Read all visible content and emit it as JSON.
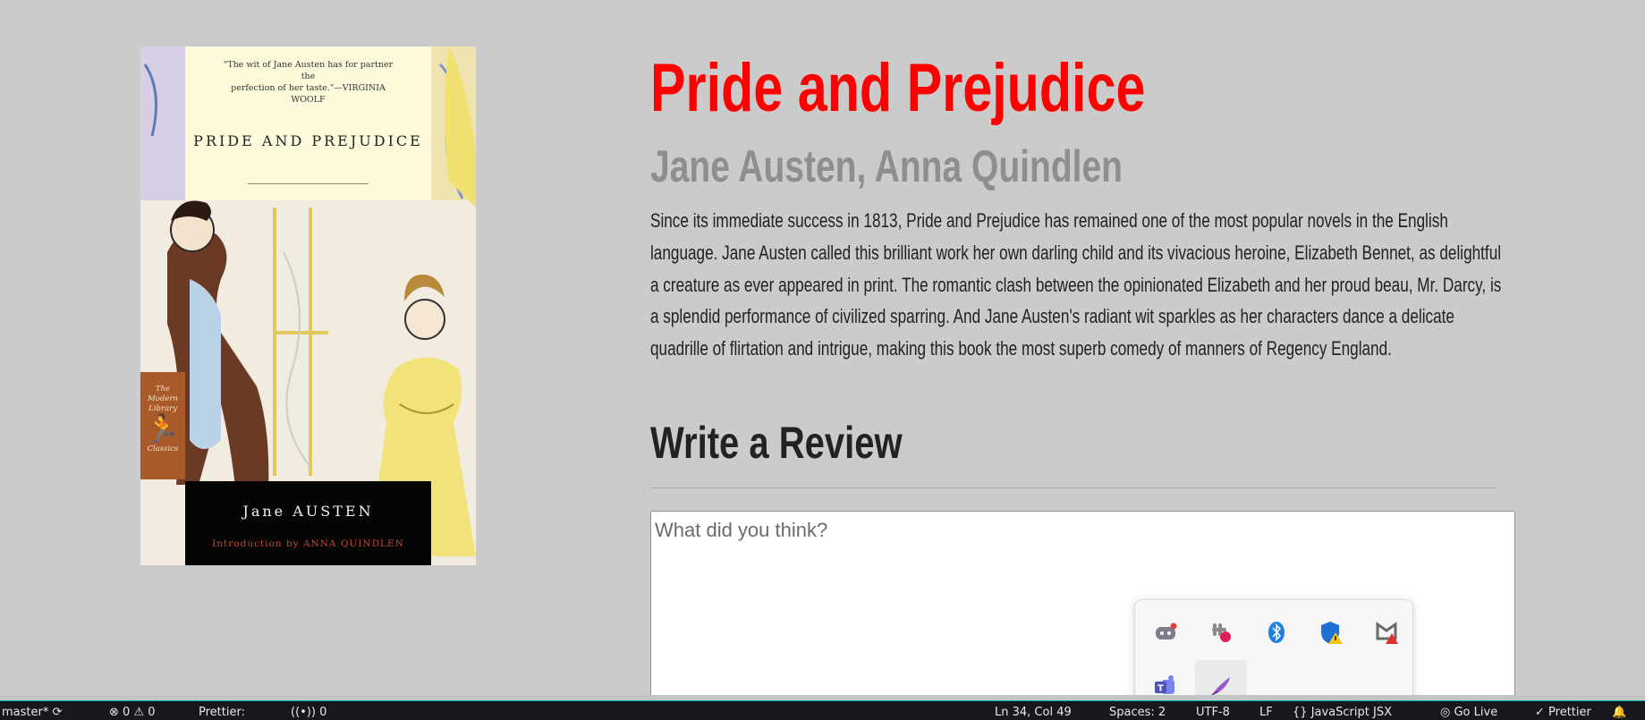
{
  "book": {
    "title": "Pride and Prejudice",
    "authors": "Jane Austen, Anna Quindlen",
    "description": "Since its immediate success in 1813, Pride and Prejudice has remained one of the most popular novels in the English language. Jane Austen called this brilliant work her own darling child and its vivacious heroine, Elizabeth Bennet, as delightful a creature as ever appeared in print. The romantic clash between the opinionated Elizabeth and her proud beau, Mr. Darcy, is a splendid performance of civilized sparring. And Jane Austen's radiant wit sparkles as her characters dance a delicate quadrille of flirtation and intrigue, making this book the most superb comedy of manners of Regency England."
  },
  "cover": {
    "quote_line1": "\"The wit of Jane Austen has for partner the",
    "quote_line2": "perfection of her taste.\"—VIRGINIA WOOLF",
    "title": "PRIDE AND PREJUDICE",
    "author": "Jane AUSTEN",
    "intro": "Introduction by ANNA QUINDLEN",
    "badge_line1": "The",
    "badge_line2": "Modern",
    "badge_line3": "Library",
    "badge_line4": "Classics"
  },
  "review": {
    "heading": "Write a Review",
    "placeholder": "What did you think?"
  },
  "tray": {
    "icons": [
      "discord-icon",
      "slack-icon",
      "bluetooth-icon",
      "windows-security-icon",
      "mcafee-icon",
      "teams-icon",
      "pen-icon"
    ]
  },
  "statusbar": {
    "branch": "master*",
    "errors": "0",
    "warnings": "0",
    "prettier_left": "Prettier:",
    "ports": "0",
    "cursor": "Ln 34, Col 49",
    "spaces": "Spaces: 2",
    "encoding": "UTF-8",
    "eol": "LF",
    "language": "JavaScript JSX",
    "go_live": "Go Live",
    "prettier_right": "Prettier"
  },
  "colors": {
    "title": "#ff0000",
    "authors": "#8e8e8e",
    "page_bg": "#cbcbcb",
    "statusbar_bg": "#16181d"
  }
}
